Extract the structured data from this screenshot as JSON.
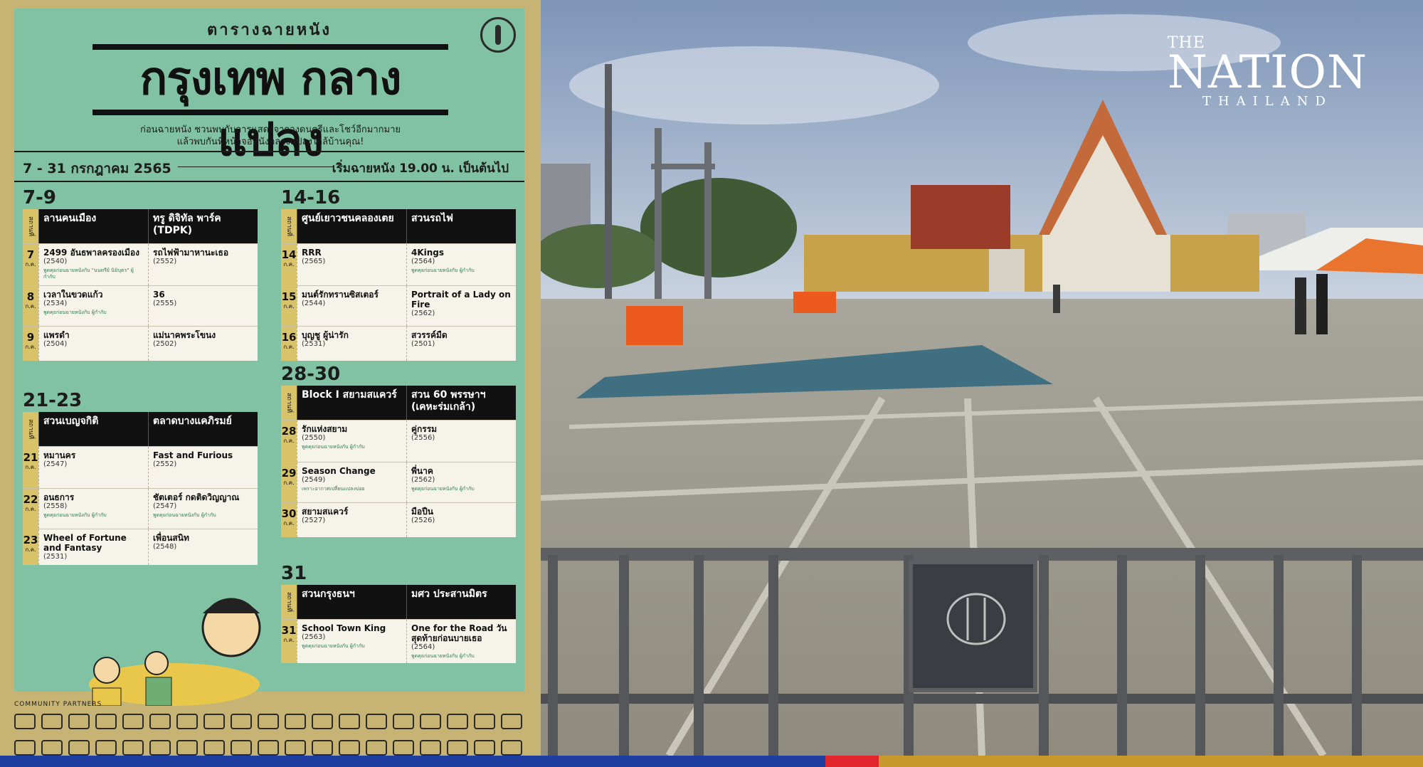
{
  "poster": {
    "subtitle": "ตารางฉายหนัง",
    "title": "กรุงเทพ กลางแปลง",
    "desc_line1": "ก่อนฉายหนัง ชวนพบกับการแสดงจากวงดนตรีและโชว์อีกมากมาย",
    "desc_line2": "แล้วพบกันที่หน้าจอหนังกลางแปลงใกล้บ้านคุณ!",
    "date_range": "7 - 31 กรกฎาคม 2565",
    "start_time": "เริ่มฉายหนัง 19.00 น. เป็นต้นไป",
    "venue_label": "สถานที่",
    "month_abbr": "ก.ค.",
    "blocks": [
      {
        "heading": "7-9",
        "venues": [
          "ลานคนเมือง",
          "ทรู ดิจิทัล พาร์ค (TDPK)"
        ],
        "rows": [
          {
            "day": "7",
            "films": [
              {
                "title": "2499 อันธพาลครองเมือง",
                "year": "(2540)",
                "note": "พูดคุยก่อนฉายหนังกับ \"นนทรีย์ นิมิบุตร\" ผู้กำกับ"
              },
              {
                "title": "รถไฟฟ้ามาหานะเธอ",
                "year": "(2552)",
                "note": ""
              }
            ]
          },
          {
            "day": "8",
            "films": [
              {
                "title": "เวลาในขวดแก้ว",
                "year": "(2534)",
                "note": "พูดคุยก่อนฉายหนังกับ ผู้กำกับ"
              },
              {
                "title": "36",
                "year": "(2555)",
                "note": ""
              }
            ]
          },
          {
            "day": "9",
            "films": [
              {
                "title": "แพรดำ",
                "year": "(2504)",
                "note": ""
              },
              {
                "title": "แม่นาคพระโขนง",
                "year": "(2502)",
                "note": ""
              }
            ]
          }
        ]
      },
      {
        "heading": "21-23",
        "venues": [
          "สวนเบญจกิติ",
          "ตลาดบางแคภิรมย์"
        ],
        "rows": [
          {
            "day": "21",
            "films": [
              {
                "title": "หมานคร",
                "year": "(2547)",
                "note": ""
              },
              {
                "title": "Fast and Furious",
                "year": "(2552)",
                "note": ""
              }
            ]
          },
          {
            "day": "22",
            "films": [
              {
                "title": "อนธการ",
                "year": "(2558)",
                "note": "พูดคุยก่อนฉายหนังกับ ผู้กำกับ"
              },
              {
                "title": "ชัตเตอร์ กดติดวิญญาณ",
                "year": "(2547)",
                "note": "พูดคุยก่อนฉายหนังกับ ผู้กำกับ"
              }
            ]
          },
          {
            "day": "23",
            "films": [
              {
                "title": "Wheel of Fortune and Fantasy",
                "year": "(2531)",
                "note": ""
              },
              {
                "title": "เพื่อนสนิท",
                "year": "(2548)",
                "note": ""
              }
            ]
          }
        ]
      },
      {
        "heading": "14-16",
        "venues": [
          "ศูนย์เยาวชนคลองเตย",
          "สวนรถไฟ"
        ],
        "rows": [
          {
            "day": "14",
            "films": [
              {
                "title": "RRR",
                "year": "(2565)",
                "note": ""
              },
              {
                "title": "4Kings",
                "year": "(2564)",
                "note": "พูดคุยก่อนฉายหนังกับ ผู้กำกับ"
              }
            ]
          },
          {
            "day": "15",
            "films": [
              {
                "title": "มนต์รักทรานซิสเตอร์",
                "year": "(2544)",
                "note": ""
              },
              {
                "title": "Portrait of a Lady on Fire",
                "year": "(2562)",
                "note": ""
              }
            ]
          },
          {
            "day": "16",
            "films": [
              {
                "title": "บุญชู ผู้น่ารัก",
                "year": "(2531)",
                "note": ""
              },
              {
                "title": "สวรรค์มืด",
                "year": "(2501)",
                "note": ""
              }
            ]
          }
        ]
      },
      {
        "heading": "28-30",
        "venues": [
          "Block I สยามสแควร์",
          "สวน 60 พรรษาฯ (เคหะร่มเกล้า)"
        ],
        "rows": [
          {
            "day": "28",
            "films": [
              {
                "title": "รักแห่งสยาม",
                "year": "(2550)",
                "note": "พูดคุยก่อนฉายหนังกับ ผู้กำกับ"
              },
              {
                "title": "คู่กรรม",
                "year": "(2556)",
                "note": ""
              }
            ]
          },
          {
            "day": "29",
            "films": [
              {
                "title": "Season Change",
                "year": "(2549)",
                "note": "เพราะอากาศเปลี่ยนแปลงบ่อย"
              },
              {
                "title": "พี่นาค",
                "year": "(2562)",
                "note": "พูดคุยก่อนฉายหนังกับ ผู้กำกับ"
              }
            ]
          },
          {
            "day": "30",
            "films": [
              {
                "title": "สยามสแควร์",
                "year": "(2527)",
                "note": ""
              },
              {
                "title": "มือปืน",
                "year": "(2526)",
                "note": ""
              }
            ]
          }
        ]
      },
      {
        "heading": "31",
        "venues": [
          "สวนกรุงธนฯ",
          "มศว ประสานมิตร"
        ],
        "rows": [
          {
            "day": "31",
            "films": [
              {
                "title": "School Town King",
                "year": "(2563)",
                "note": "พูดคุยก่อนฉายหนังกับ ผู้กำกับ"
              },
              {
                "title": "One for the Road วันสุดท้ายก่อนบายเธอ",
                "year": "(2564)",
                "note": "พูดคุยก่อนฉายหนังกับ ผู้กำกับ"
              }
            ]
          }
        ]
      }
    ],
    "partners_label": "COMMUNITY PARTNERS"
  },
  "brand": {
    "the": "THE",
    "nation": "NATION",
    "thailand": "THAILAND"
  },
  "colors": {
    "poster_bg": "#82c2a4",
    "poster_frame": "#c7b475",
    "strip_blue": "#1f3fa0",
    "strip_red": "#e0262b",
    "strip_gold": "#c89a2e"
  }
}
